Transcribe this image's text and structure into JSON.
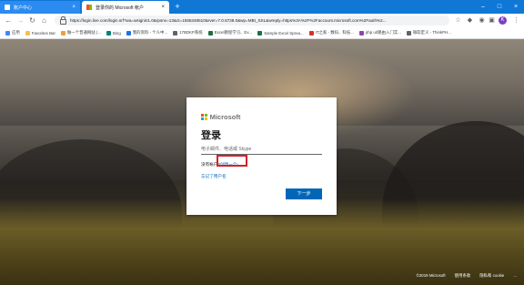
{
  "browser": {
    "tabs": [
      {
        "label": "账户中心",
        "active": false
      },
      {
        "label": "登录你的 Microsoft 帐户",
        "active": true
      }
    ],
    "address": "https://login.live.com/login.srf?wa=wsignin1.0&rpsnv=13&ct=1555348510&rver=7.0.6738.0&wp=MBI_SSL&wreply=https%3A%2F%2Faccount.microsoft.com%2Fauth%2..."
  },
  "bookmarks": [
    {
      "label": "应用",
      "color": "#4285f4"
    },
    {
      "label": "Favorites Bar",
      "color": "#f2c14e"
    },
    {
      "label": "做一个普通网站 (...",
      "color": "#e8a33d"
    },
    {
      "label": "Bing",
      "color": "#008373"
    },
    {
      "label": "我的资料 - 个人中...",
      "color": "#1a73e8"
    },
    {
      "label": "17BDKP系统",
      "color": "#5f6368"
    },
    {
      "label": "Excel教程学习、Ex...",
      "color": "#1d6f42"
    },
    {
      "label": "Sample Excel Sprea...",
      "color": "#1d6f42"
    },
    {
      "label": "IT之家 - 数码、科技...",
      "color": "#d93025"
    },
    {
      "label": "php url路由入门实...",
      "color": "#8e44ad"
    },
    {
      "label": "微软定义 - ThinkPH...",
      "color": "#5f6368"
    }
  ],
  "login": {
    "brand": "Microsoft",
    "logo_colors": [
      "#f25022",
      "#7fba00",
      "#00a4ef",
      "#ffb900"
    ],
    "heading": "登录",
    "email_placeholder": "电子邮件、电话或 Skype",
    "no_account": "没有帐户?",
    "create_link": "创建一个!",
    "forgot": "忘记了用户名",
    "next_button": "下一步"
  },
  "footer": {
    "copyright": "©2019 Microsoft",
    "terms": "使用条款",
    "privacy": "隐私和 cookie",
    "more": "..."
  },
  "colors": {
    "accent": "#0067b8",
    "highlight_box": "#d6202a",
    "titlebar": "#0f78d7"
  }
}
